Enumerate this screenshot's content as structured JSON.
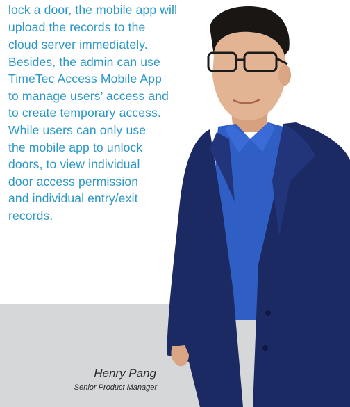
{
  "article": {
    "lines": [
      "lock a door, the mobile app will",
      "upload the records to the",
      "cloud server immediately.",
      "Besides, the admin can use",
      "TimeTec Access Mobile App",
      "to manage users’ access and",
      "to create temporary access.",
      "While users can only use",
      "the mobile app to unlock",
      "doors, to view individual",
      "door access permission",
      "and individual entry/exit",
      "records."
    ]
  },
  "quote_attribution": {
    "name": "Henry Pang",
    "title": "Senior Product  Manager"
  },
  "colors": {
    "body_text": "#2a97c7",
    "panel": "#d5d7d8",
    "suit": "#1b2a63",
    "shirt": "#2f5ec4"
  }
}
